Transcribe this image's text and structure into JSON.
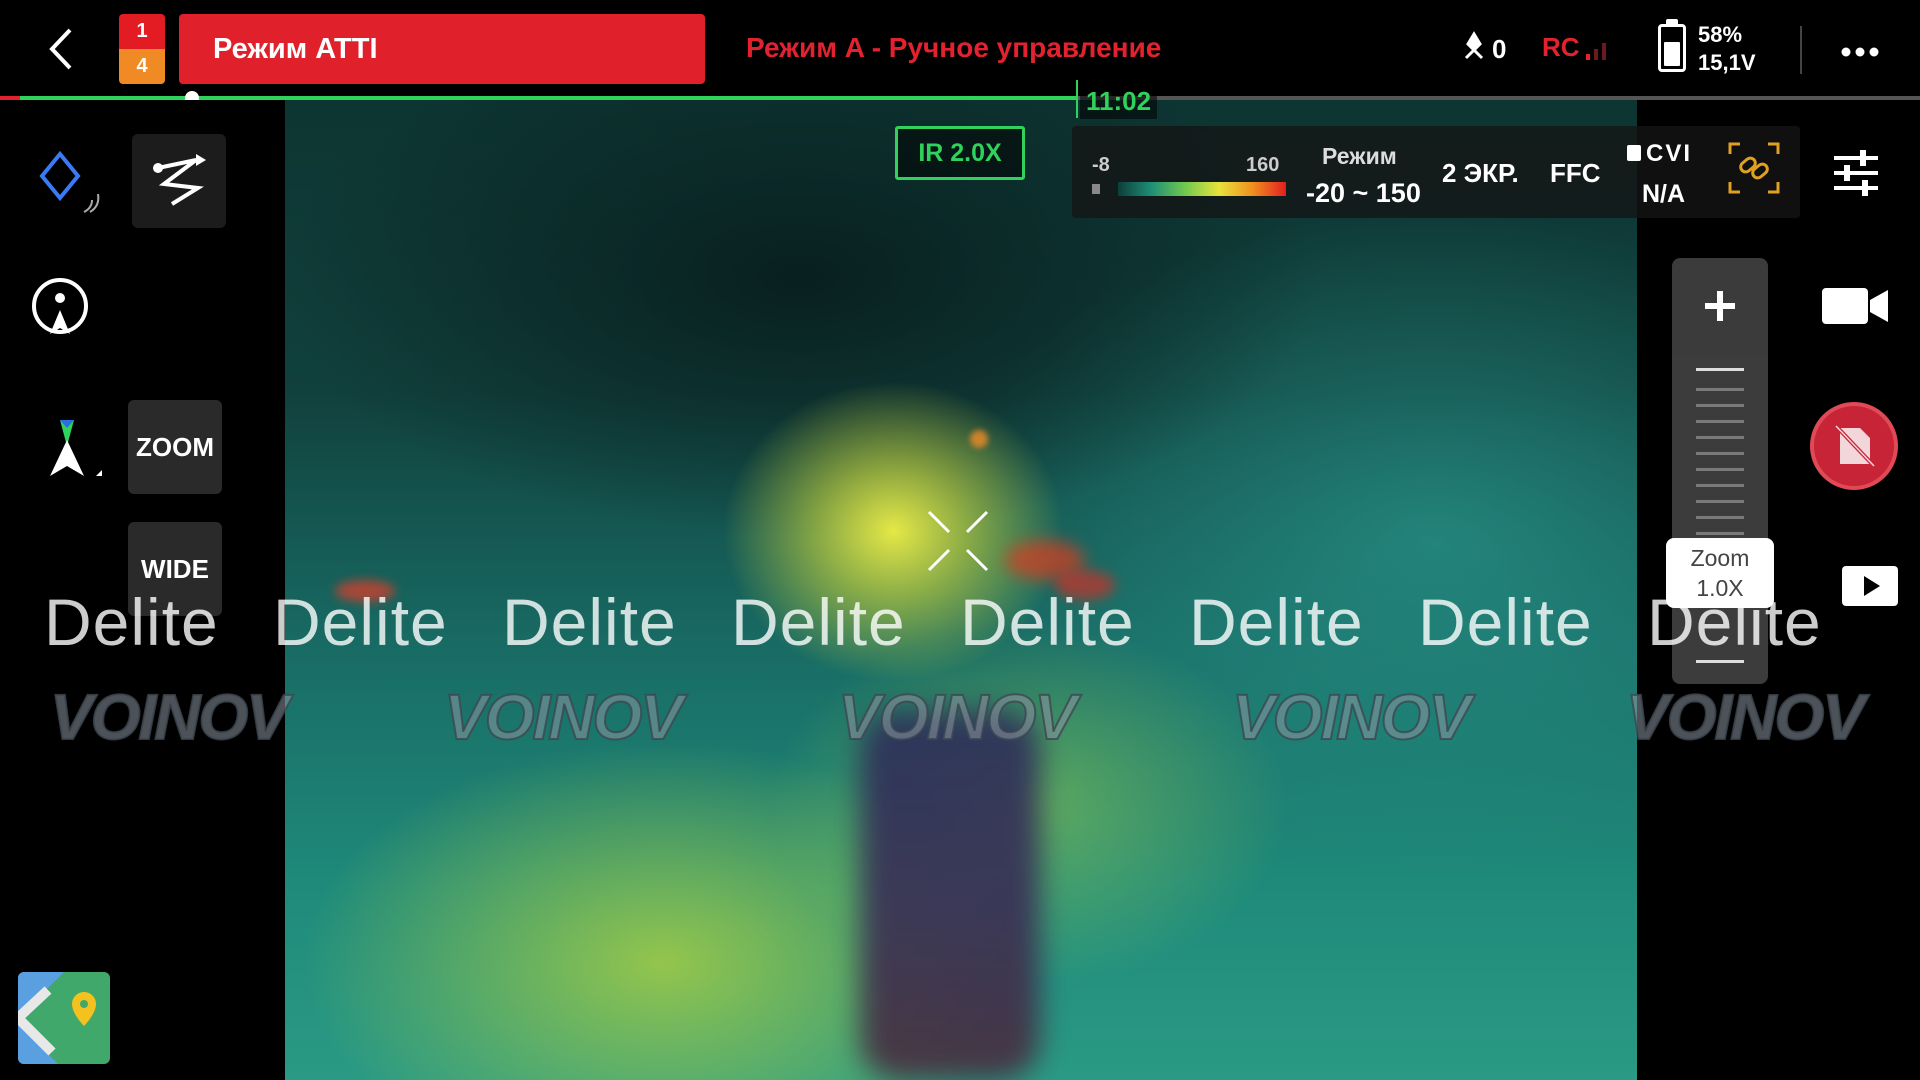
{
  "top_bar": {
    "satellite_top": "1",
    "satellite_bottom": "4",
    "flight_mode": "Режим ATTI",
    "control_mode": "Режим A - Ручное управление",
    "propeller_count": "0",
    "rc_label": "RC",
    "battery_percent": "58%",
    "battery_level": 0.58,
    "battery_voltage": "15,1V",
    "timestamp": "11:02",
    "progress_fraction": 0.56
  },
  "camera": {
    "ir_zoom": "IR 2.0X",
    "temp_min": "-8",
    "temp_max": "160",
    "range_title": "Режим",
    "range_value": "-20 ~ 150",
    "screens": "2 ЭКР.",
    "ffc": "FFC",
    "cvi": "CVI",
    "cvi_status": "N/A"
  },
  "left_panel": {
    "zoom_label": "ZOOM",
    "wide_label": "WIDE"
  },
  "right_panel": {
    "zoom_title": "Zoom",
    "zoom_value": "1.0X",
    "zoom_fraction": 0.0
  },
  "watermarks": {
    "text_items": [
      "Delite",
      "Delite",
      "Delite",
      "Delite",
      "Delite",
      "Delite",
      "Delite",
      "Delite"
    ],
    "logo_items": [
      "VOINOV",
      "VOINOV",
      "VOINOV",
      "VOINOV",
      "VOINOV"
    ]
  },
  "colors": {
    "mode_red": "#e0202b",
    "accent_green": "#2fd25a",
    "warn_orange": "#f08a24"
  }
}
